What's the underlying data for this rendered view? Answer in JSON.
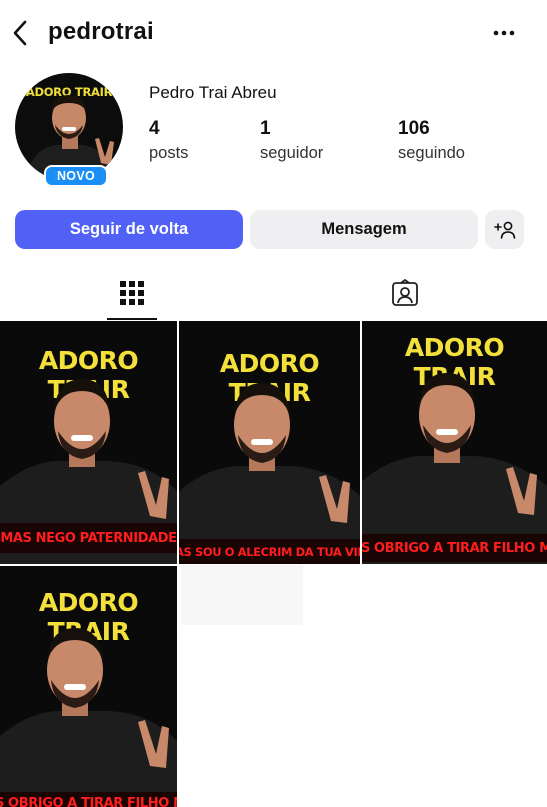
{
  "header": {
    "username": "pedrotrai"
  },
  "profile": {
    "full_name": "Pedro Trai Abreu",
    "avatar_text": "ADORO TRAIR",
    "new_badge": "NOVO",
    "stats": {
      "posts": {
        "value": "4",
        "label": "posts"
      },
      "followers": {
        "value": "1",
        "label": "seguidor"
      },
      "following": {
        "value": "106",
        "label": "seguindo"
      }
    }
  },
  "actions": {
    "follow_back": "Seguir de volta",
    "message": "Mensagem"
  },
  "tabs": [
    "grid-icon",
    "tagged-icon"
  ],
  "posts": [
    {
      "title": "ADORO TRAIR",
      "caption": "MAS NEGO PATERNIDADE"
    },
    {
      "title": "ADORO TRAIR",
      "caption": "MAS SOU O ALECRIM DA TUA VIDA"
    },
    {
      "title": "ADORO TRAIR",
      "caption": "MAS OBRIGO A TIRAR FILHO MEU"
    },
    {
      "title": "ADORO TRAIR",
      "caption": "MAS OBRIGO A TIRAR FILHO MEU"
    }
  ],
  "colors": {
    "follow_button": "#5161f6",
    "secondary_button": "#efeff2",
    "badge": "#1a8ef5",
    "post_title": "#f3e03a",
    "post_caption": "#ff1d1d"
  }
}
